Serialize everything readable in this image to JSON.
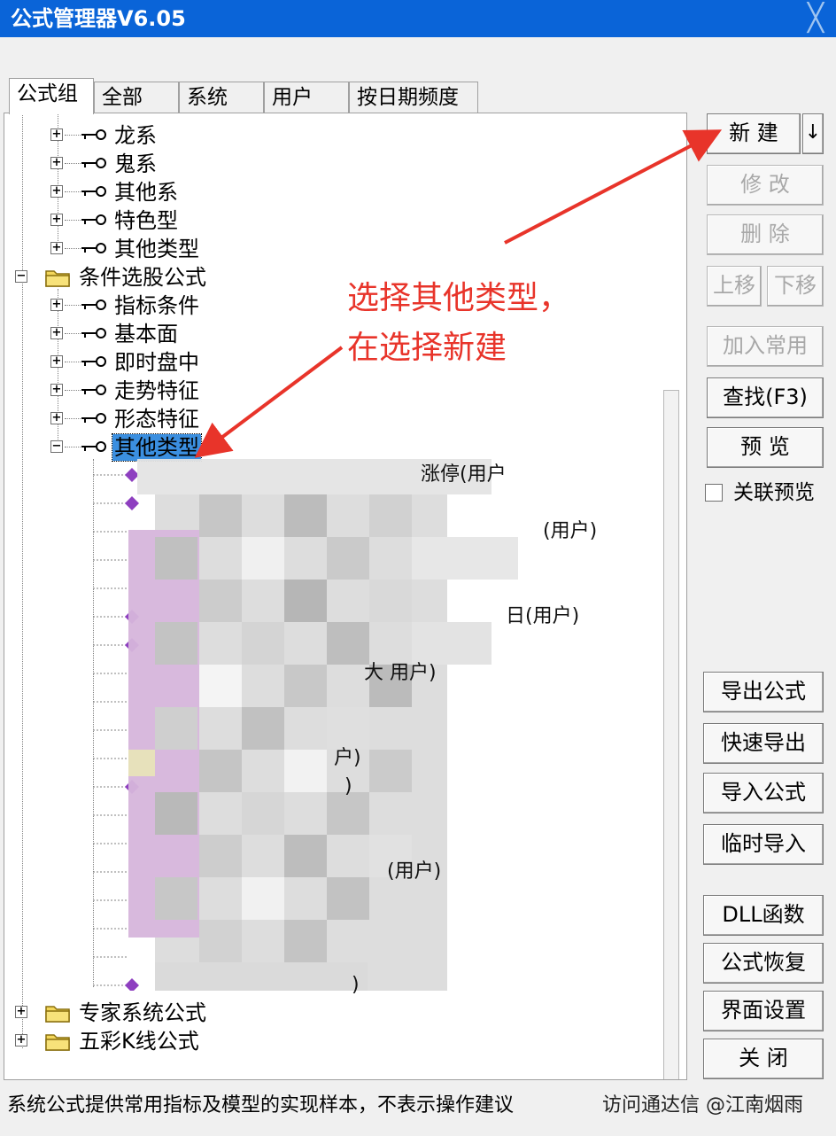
{
  "window": {
    "title": "公式管理器V6.05",
    "close_label": "╳"
  },
  "tabs": [
    {
      "label": "公式组"
    },
    {
      "label": "全部"
    },
    {
      "label": "系统"
    },
    {
      "label": "用户"
    },
    {
      "label": "按日期频度"
    }
  ],
  "tree": {
    "group1_children": [
      {
        "label": "龙系"
      },
      {
        "label": "鬼系"
      },
      {
        "label": "其他系"
      },
      {
        "label": "特色型"
      },
      {
        "label": "其他类型"
      }
    ],
    "folder_condition": {
      "label": "条件选股公式"
    },
    "condition_children": [
      {
        "label": "指标条件"
      },
      {
        "label": "基本面"
      },
      {
        "label": "即时盘中"
      },
      {
        "label": "走势特征"
      },
      {
        "label": "形态特征"
      },
      {
        "label": "其他类型"
      }
    ],
    "partial_items": [
      {
        "text": "涨停(用户"
      },
      {
        "text": "(用户)"
      },
      {
        "text": "日(用户)"
      },
      {
        "text": "大 用户)"
      },
      {
        "text": "户)"
      },
      {
        "text": ")"
      },
      {
        "text": "(用户)"
      },
      {
        "text": ")"
      }
    ],
    "folder_expert": {
      "label": "专家系统公式"
    },
    "folder_kline": {
      "label": "五彩K线公式"
    }
  },
  "annotation": {
    "line1": "选择其他类型，",
    "line2": "在选择新建",
    "color": "#e8342a"
  },
  "buttons": {
    "new": "新  建",
    "new_dropdown": "↓",
    "modify": "修 改",
    "delete": "删 除",
    "move_up": "上移",
    "move_down": "下移",
    "add_common": "加入常用",
    "find": "查找(F3)",
    "preview": "预 览",
    "link_preview": "关联预览",
    "export": "导出公式",
    "quick_export": "快速导出",
    "import": "导入公式",
    "temp_import": "临时导入",
    "dll": "DLL函数",
    "restore": "公式恢复",
    "ui_settings": "界面设置",
    "close": "关 闭"
  },
  "status": {
    "left": "系统公式提供常用指标及模型的实现样本，不表示操作建议",
    "right": "访问通达信 @江南烟雨"
  }
}
